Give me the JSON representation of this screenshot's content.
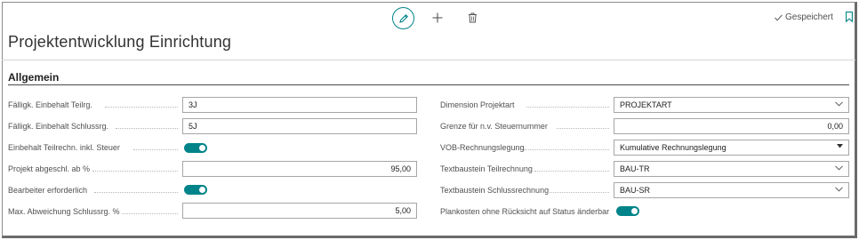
{
  "toolbar": {
    "status": "Gespeichert",
    "icons": [
      "pencil-icon",
      "plus-icon",
      "trash-icon",
      "check-icon",
      "bookmark-icon"
    ]
  },
  "page": {
    "title": "Projektentwicklung Einrichtung"
  },
  "section": {
    "title": "Allgemein"
  },
  "left_fields": [
    {
      "label": "Fälligk. Einbehalt Teilrg.",
      "type": "text",
      "value": "3J"
    },
    {
      "label": "Fälligk. Einbehalt Schlussrg.",
      "type": "text",
      "value": "5J"
    },
    {
      "label": "Einbehalt Teilrechn. inkl. Steuer",
      "type": "toggle",
      "value": true
    },
    {
      "label": "Projekt abgeschl. ab %",
      "type": "number",
      "value": "95,00"
    },
    {
      "label": "Bearbeiter erforderlich",
      "type": "toggle",
      "value": true
    },
    {
      "label": "Max. Abweichung Schlussrg. %",
      "type": "number",
      "value": "5,00"
    }
  ],
  "right_fields": [
    {
      "label": "Dimension Projektart",
      "type": "dropdown",
      "value": "PROJEKTART"
    },
    {
      "label": "Grenze für n.v. Steuernummer",
      "type": "number",
      "value": "0,00"
    },
    {
      "label": "VOB-Rechnungslegung",
      "type": "select",
      "value": "Kumulative Rechnungslegung"
    },
    {
      "label": "Textbaustein Teilrechnung",
      "type": "dropdown",
      "value": "BAU-TR"
    },
    {
      "label": "Textbaustein Schlussrechnung",
      "type": "dropdown",
      "value": "BAU-SR"
    },
    {
      "label": "Plankosten ohne Rücksicht auf Status änderbar",
      "type": "toggle",
      "value": true
    }
  ],
  "colors": {
    "accent": "#008489",
    "border": "#a6a6a6",
    "label": "#505050"
  }
}
